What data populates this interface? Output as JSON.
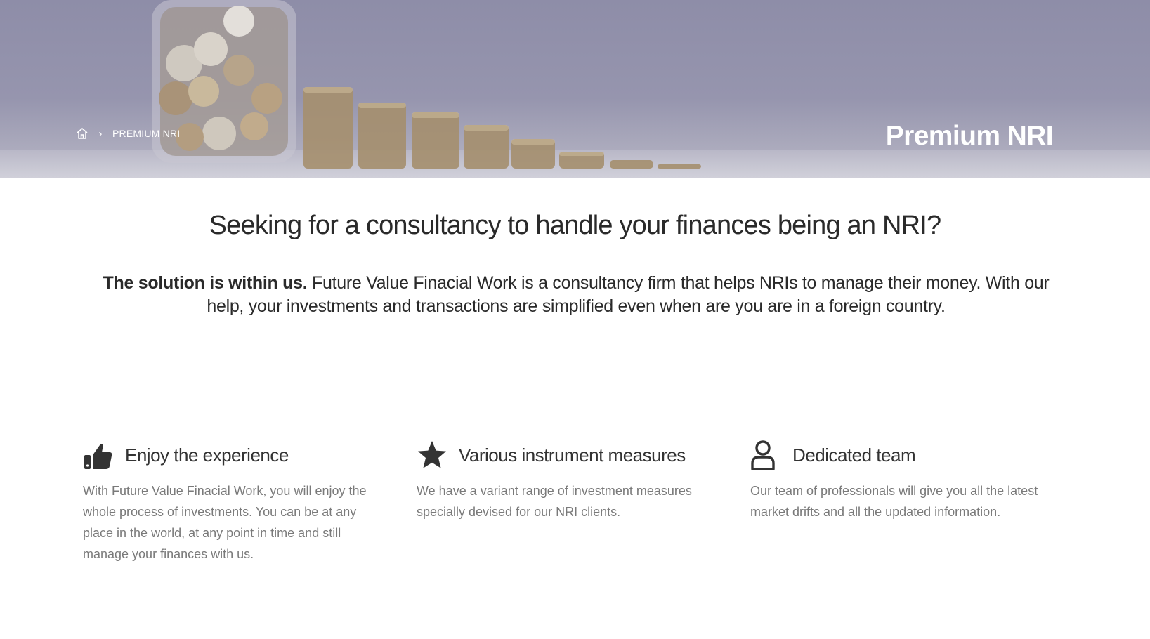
{
  "hero": {
    "breadcrumb": {
      "home_icon": "home-icon",
      "separator": "›",
      "current": "PREMIUM NRI"
    },
    "title": "Premium NRI"
  },
  "headline": "Seeking for a consultancy to handle your finances being an NRI?",
  "intro": {
    "bold": "The solution is within us.",
    "rest": " Future Value Finacial Work is a consultancy firm that helps NRIs to manage their money. With our help, your investments and transactions are simplified even when are you are in a foreign country."
  },
  "features": [
    {
      "icon": "thumbs-up-icon",
      "title": "Enjoy the experience",
      "text": "With Future Value Finacial Work, you will enjoy the whole process of investments. You can be at any place in the world, at any point in time and still manage your finances with us."
    },
    {
      "icon": "star-icon",
      "title": "Various instrument measures",
      "text": "We have a variant range of investment measures specially devised for our NRI clients."
    },
    {
      "icon": "user-icon",
      "title": "Dedicated team",
      "text": "Our team of professionals will give you all the latest market drifts and all the updated information."
    }
  ],
  "colors": {
    "hero_tint": "#8e8da8",
    "heading": "#2a2a2a",
    "body_text": "#7a7a7a",
    "icon": "#333333"
  }
}
